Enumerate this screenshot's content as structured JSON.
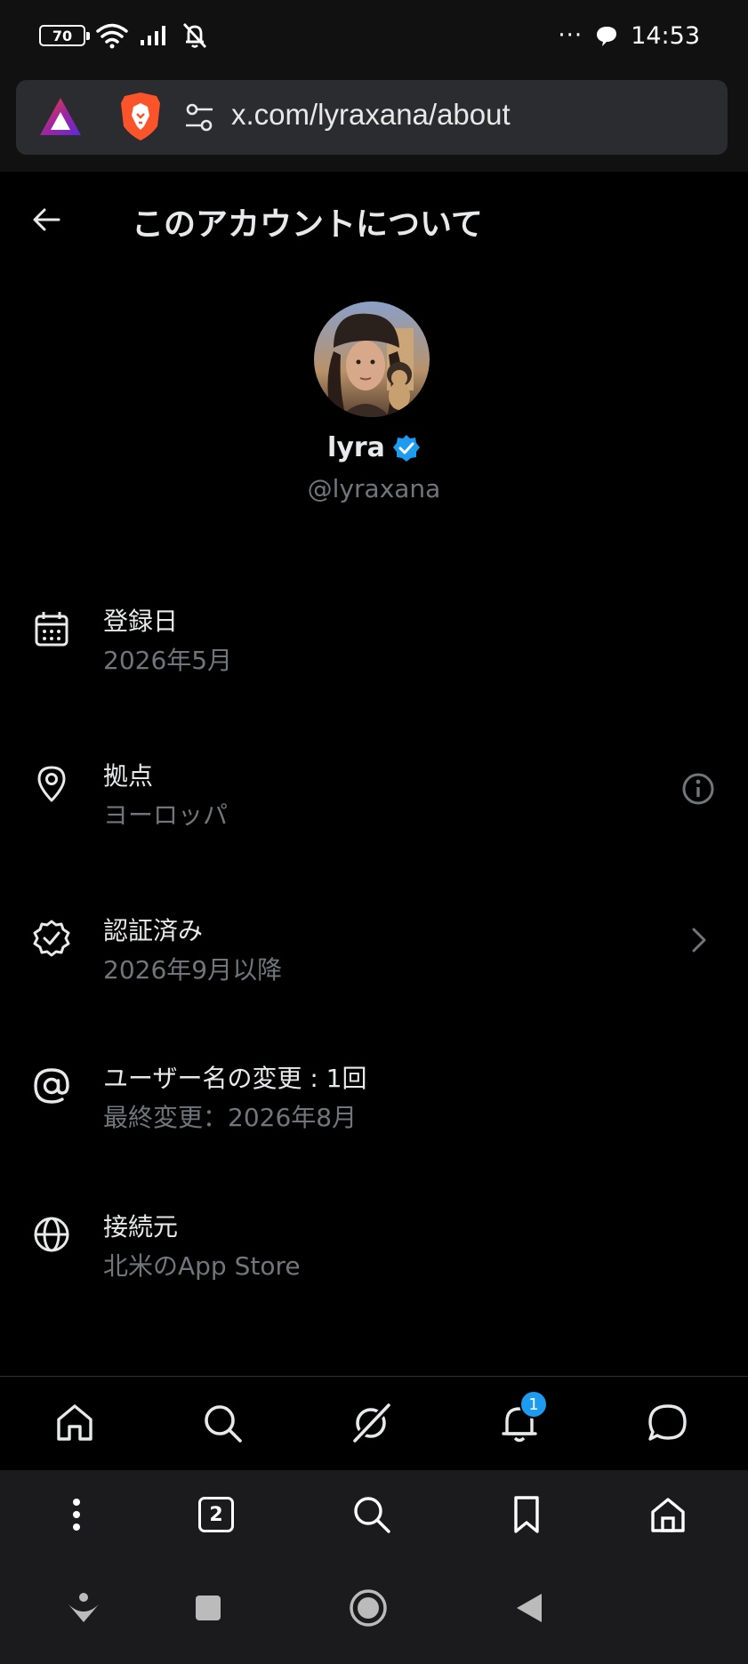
{
  "status_bar": {
    "battery": "70",
    "time": "14:53",
    "more_dots": "···"
  },
  "browser": {
    "url": "x.com/lyraxana/about",
    "tab_count": "2"
  },
  "header": {
    "title": "このアカウントについて"
  },
  "profile": {
    "display_name": "lyra",
    "handle": "@lyraxana",
    "verified_color": "#1d9bf0"
  },
  "info_rows": [
    {
      "icon": "calendar-icon",
      "label": "登録日",
      "value": "2026年5月"
    },
    {
      "icon": "location-pin-icon",
      "label": "拠点",
      "value": "ヨーロッパ"
    },
    {
      "icon": "verified-badge-icon",
      "label": "認証済み",
      "value": "2026年9月以降"
    },
    {
      "icon": "at-sign-icon",
      "label": "ユーザー名の変更 : 1回",
      "value": "最終変更：2026年8月"
    },
    {
      "icon": "globe-icon",
      "label": "接続元",
      "value": "北米のApp Store"
    }
  ],
  "app_nav": {
    "notifications_badge": "1"
  },
  "colors": {
    "background": "#000000",
    "text_primary": "#e7e9ea",
    "text_secondary": "#71767b",
    "accent": "#1d9bf0"
  }
}
